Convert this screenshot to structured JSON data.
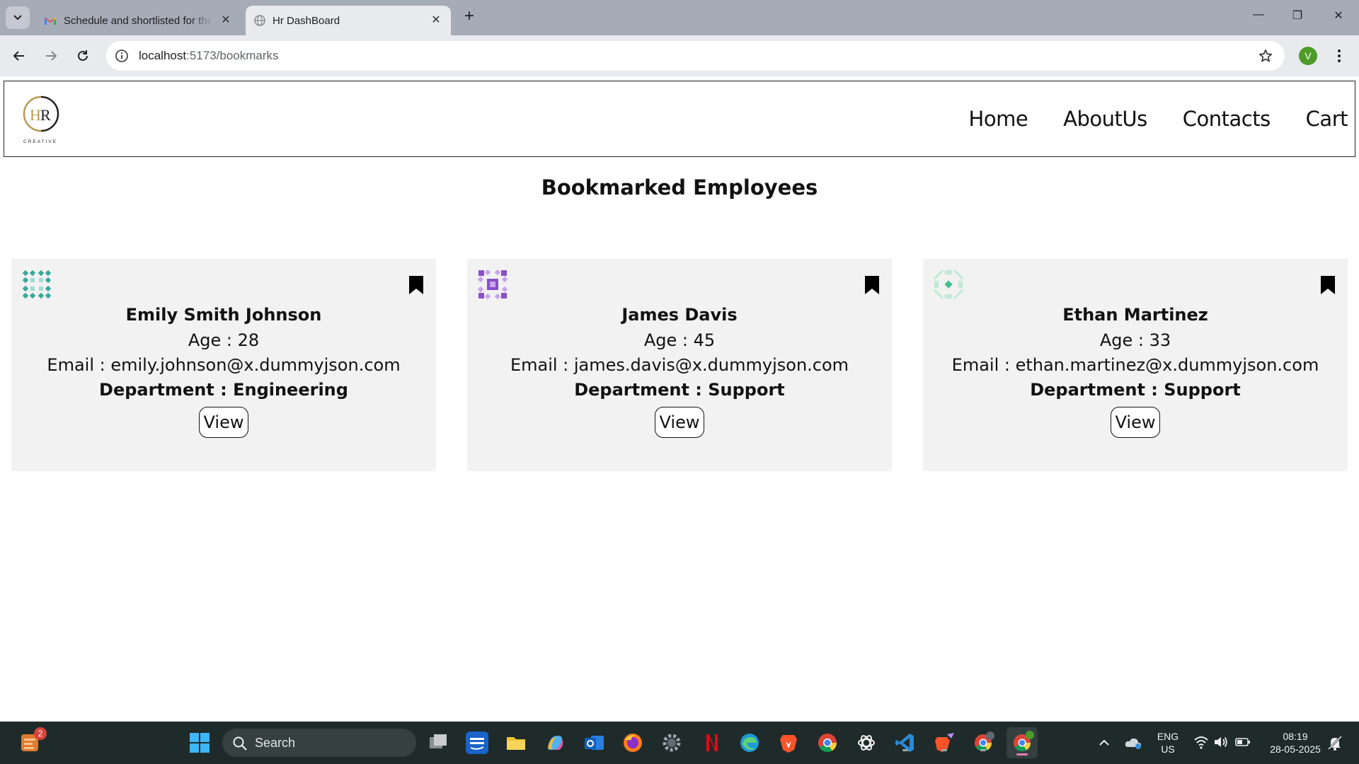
{
  "browser": {
    "tabs": [
      {
        "title": "Schedule and shortlisted for the",
        "active": false,
        "favicon": "gmail-icon"
      },
      {
        "title": "Hr DashBoard",
        "active": true,
        "favicon": "globe-icon"
      }
    ],
    "url_host": "localhost",
    "url_path": ":5173/bookmarks",
    "profile_initial": "V"
  },
  "site": {
    "logo_alt": "HR",
    "logo_subtext": "CREATIVE",
    "nav": [
      "Home",
      "AboutUs",
      "Contacts",
      "Cart"
    ]
  },
  "page": {
    "title": "Bookmarked Employees",
    "employees": [
      {
        "name": "Emily Smith Johnson",
        "age": "Age : 28",
        "email": "Email : emily.johnson@x.dummyjson.com",
        "department": "Department : Engineering",
        "button": "View",
        "avatar_color": "#3aa89a"
      },
      {
        "name": "James Davis",
        "age": "Age : 45",
        "email": "Email : james.davis@x.dummyjson.com",
        "department": "Department : Support",
        "button": "View",
        "avatar_color": "#8a4fc7"
      },
      {
        "name": "Ethan Martinez",
        "age": "Age : 33",
        "email": "Email : ethan.martinez@x.dummyjson.com",
        "department": "Department : Support",
        "button": "View",
        "avatar_color": "#3fc28a"
      }
    ]
  },
  "taskbar": {
    "search_placeholder": "Search",
    "notification_count": "2",
    "language": "ENG",
    "region": "US",
    "time": "08:19",
    "date": "28-05-2025"
  }
}
